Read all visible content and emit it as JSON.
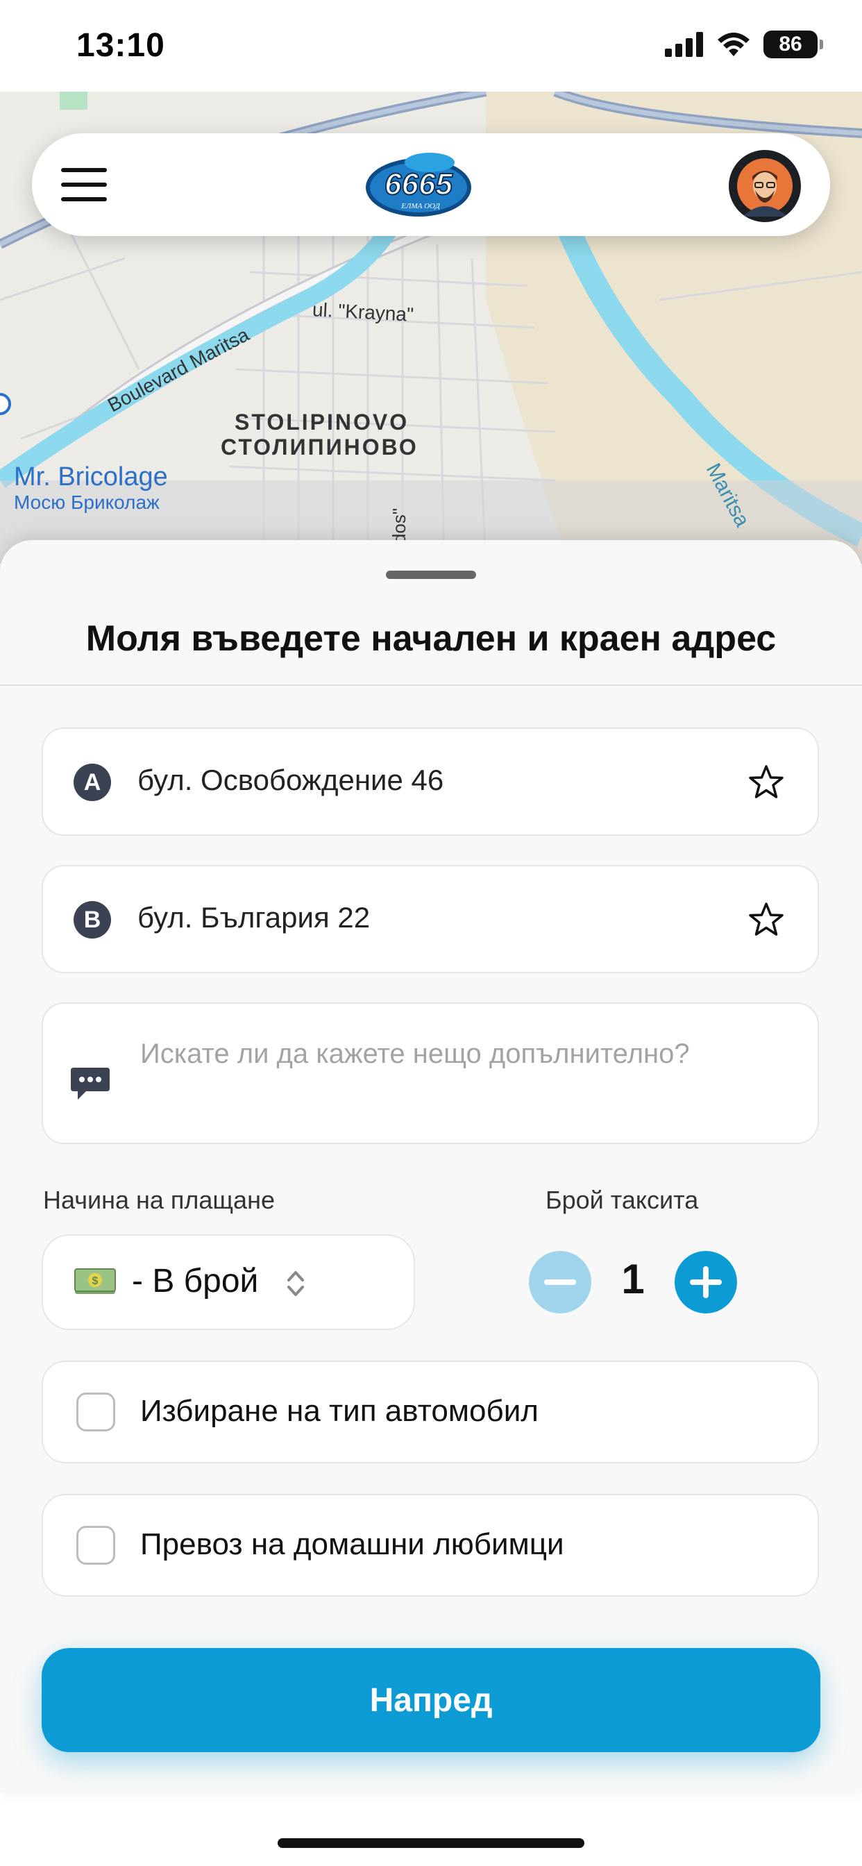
{
  "status_bar": {
    "time": "13:10",
    "battery": "86"
  },
  "map": {
    "labels": {
      "district_latin": "STOLIPINOVO",
      "district_cyrillic": "СТОЛИПИНОВО",
      "street_1": "Boulevard Maritsa",
      "street_2": "ul. \"Krayna\"",
      "river": "Maritsa",
      "street_3": "andos\""
    },
    "poi": {
      "name": "Mr. Bricolage",
      "name_local": "Мосю Бриколаж"
    }
  },
  "header": {
    "logo_text": "6665",
    "logo_sub": "ЕЛМА ООД"
  },
  "sheet": {
    "title": "Моля въведете начален и краен адрес",
    "origin": {
      "marker": "A",
      "value": "бул. Освобождение 46"
    },
    "destination": {
      "marker": "B",
      "value": "бул. България 22"
    },
    "note": {
      "placeholder": "Искате ли да кажете нещо допълнително?"
    },
    "payment": {
      "label": "Начина на плащане",
      "selected": "- В брой"
    },
    "taxi_count": {
      "label": "Брой таксита",
      "value": "1"
    },
    "options": [
      {
        "label": "Избиране на тип автомобил",
        "checked": false
      },
      {
        "label": "Превоз на домашни любимци",
        "checked": false
      }
    ],
    "next_button": "Напред"
  },
  "colors": {
    "accent": "#0d9bd6",
    "accent_light": "#9fd4ec",
    "marker": "#3b4252"
  }
}
